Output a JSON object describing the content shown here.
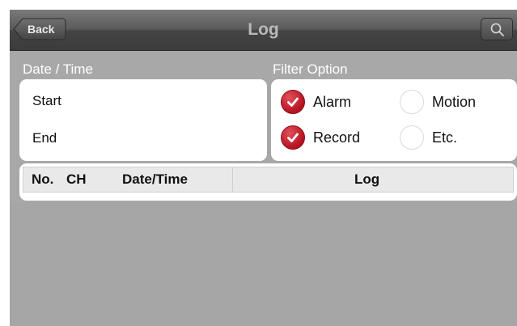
{
  "navbar": {
    "back_label": "Back",
    "title": "Log",
    "search_icon": "search-icon"
  },
  "date_time": {
    "section_label": "Date / Time",
    "start_label": "Start",
    "end_label": "End"
  },
  "filter": {
    "section_label": "Filter Option",
    "options": [
      {
        "label": "Alarm",
        "checked": true
      },
      {
        "label": "Motion",
        "checked": false
      },
      {
        "label": "Record",
        "checked": true
      },
      {
        "label": "Etc.",
        "checked": false
      }
    ]
  },
  "table": {
    "headers": [
      "No.",
      "CH",
      "Date/Time",
      "Log"
    ]
  },
  "colors": {
    "accent_checked": "#c0141f",
    "navbar": "#4a4a4a",
    "background": "#a8a8a8"
  }
}
